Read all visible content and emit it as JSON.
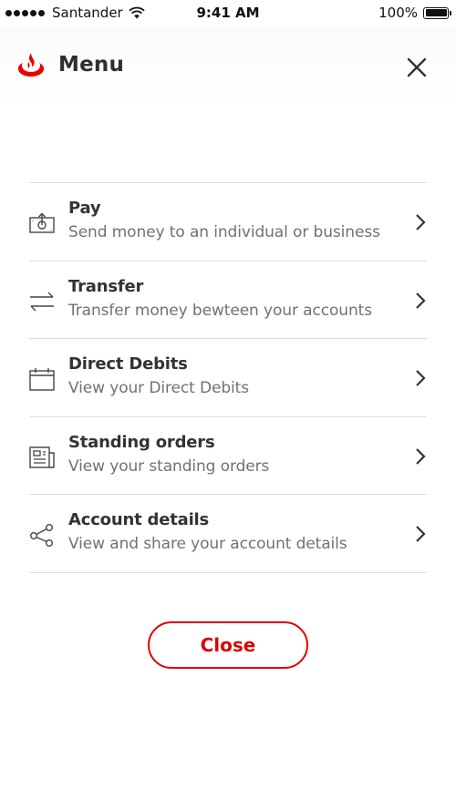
{
  "status_bar": {
    "carrier": "Santander",
    "time": "9:41 AM",
    "battery": "100%",
    "icons": [
      "signal-dots-icon",
      "wifi-icon",
      "battery-icon"
    ]
  },
  "header": {
    "title": "Menu",
    "logo_icon": "santander-flame-icon",
    "close_icon": "close-icon",
    "brand_color": "#ec0000"
  },
  "menu": {
    "items": [
      {
        "title": "Pay",
        "subtitle": "Send money to an individual or business",
        "icon": "money-pay-icon"
      },
      {
        "title": "Transfer",
        "subtitle": "Transfer money bewteen your accounts",
        "icon": "transfer-arrows-icon"
      },
      {
        "title": "Direct Debits",
        "subtitle": "View your Direct Debits",
        "icon": "calendar-icon"
      },
      {
        "title": "Standing orders",
        "subtitle": "View your standing orders",
        "icon": "document-icon"
      },
      {
        "title": "Account details",
        "subtitle": "View and share your account details",
        "icon": "share-icon"
      }
    ],
    "chevron_icon": "chevron-right-icon"
  },
  "close_button": {
    "label": "Close",
    "color": "#e00000"
  }
}
